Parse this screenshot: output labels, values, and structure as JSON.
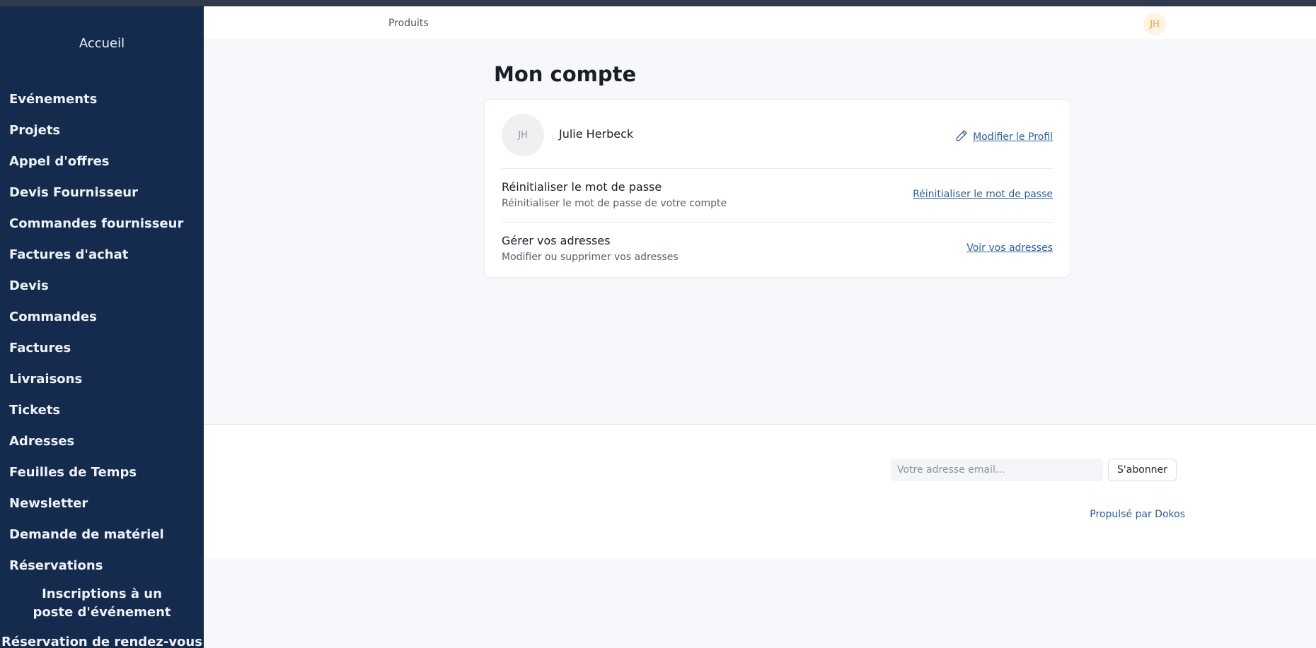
{
  "sidebar": {
    "home": "Accueil",
    "items": [
      "Evénements",
      "Projets",
      "Appel d'offres",
      "Devis Fournisseur",
      "Commandes fournisseur",
      "Factures d'achat",
      "Devis",
      "Commandes",
      "Factures",
      "Livraisons",
      "Tickets",
      "Adresses",
      "Feuilles de Temps",
      "Newsletter",
      "Demande de matériel",
      "Réservations",
      "Inscriptions à un poste d'événement",
      "Réservation de rendez-vous"
    ]
  },
  "topbar": {
    "nav_link": "Produits",
    "avatar_initials": "JH"
  },
  "main": {
    "title": "Mon compte",
    "profile": {
      "initials": "JH",
      "name": "Julie Herbeck",
      "edit_label": "Modifier le Profil"
    },
    "rows": [
      {
        "title": "Réinitialiser le mot de passe",
        "description": "Réinitialiser le mot de passe de votre compte",
        "action": "Réinitialiser le mot de passe"
      },
      {
        "title": "Gérer vos adresses",
        "description": "Modifier ou supprimer vos adresses",
        "action": "Voir vos adresses"
      }
    ]
  },
  "footer": {
    "email_placeholder": "Votre adresse email...",
    "subscribe_label": "S'abonner",
    "powered_by": "Propulsé par Dokos"
  },
  "colors": {
    "sidebar_bg": "#142b4e",
    "link": "#2a5ea6",
    "avatar_accent": "#e5a54a"
  }
}
